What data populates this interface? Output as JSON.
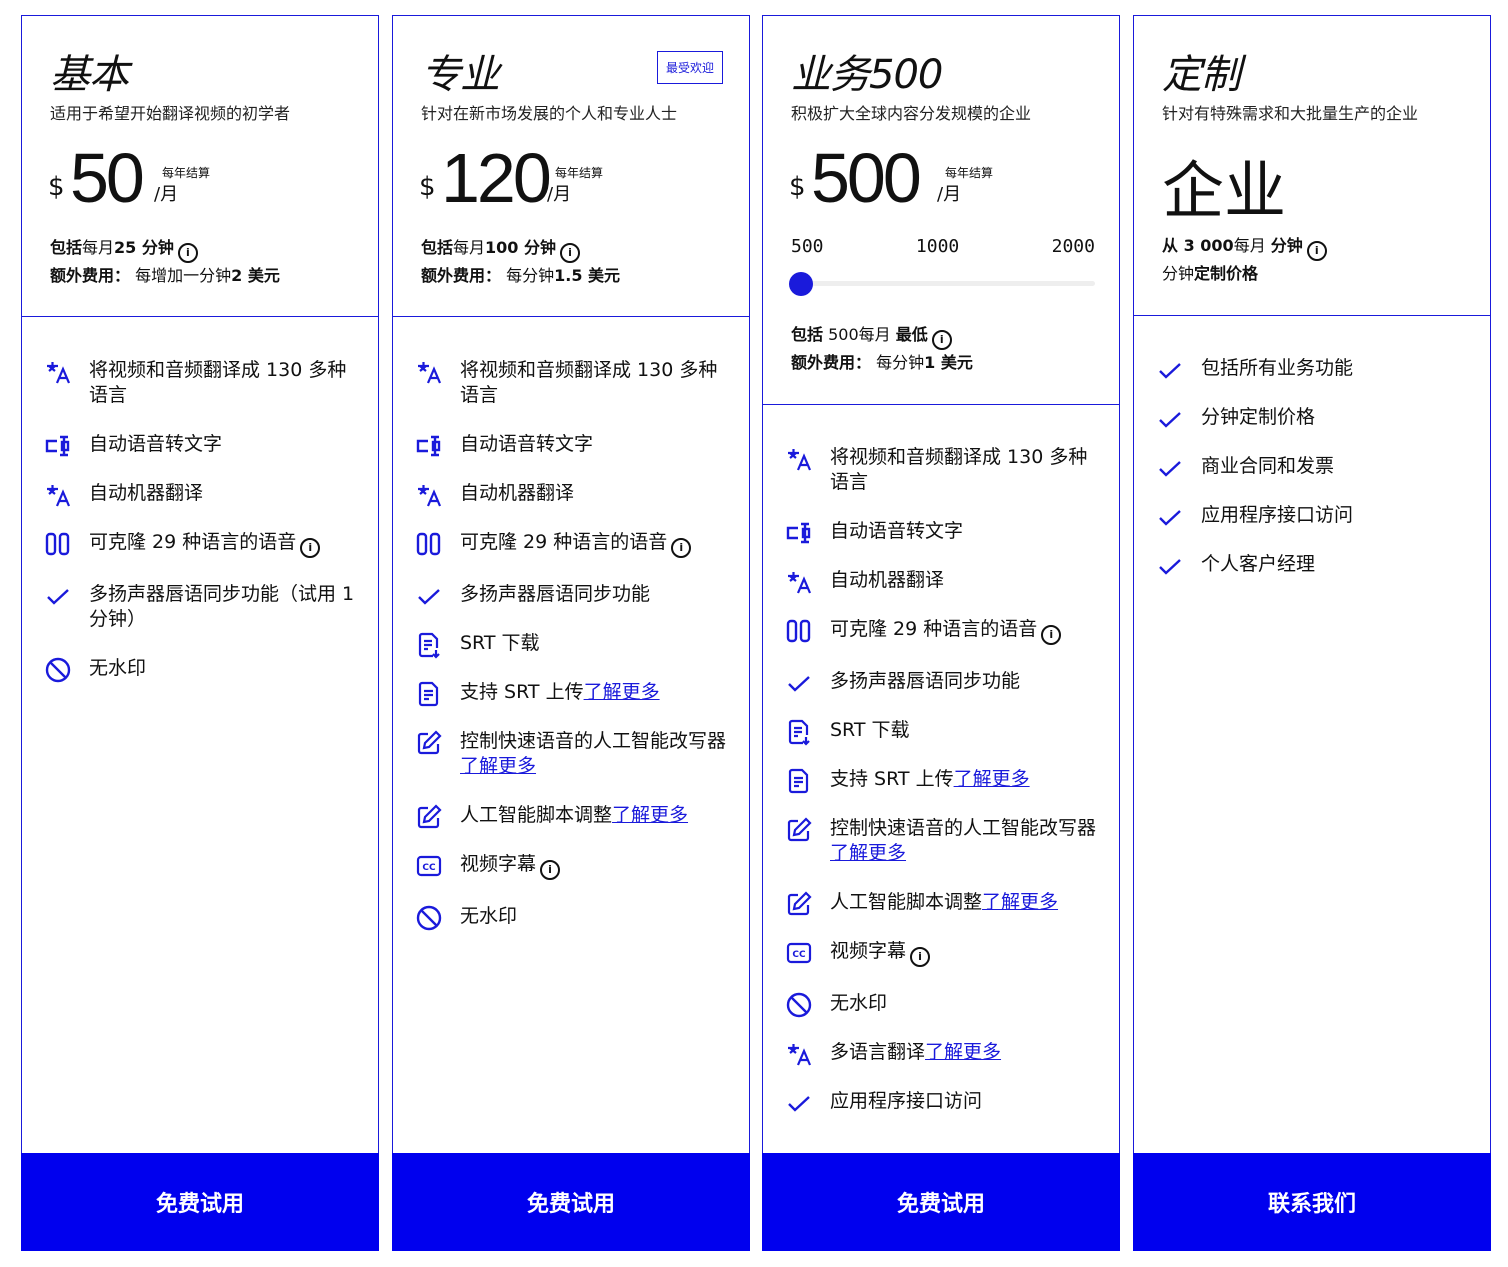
{
  "plans": [
    {
      "title": "基本",
      "subtitle": "适用于希望开始翻译视频的初学者",
      "currency": "$",
      "price": "50",
      "billing": "每年结算",
      "unit": "/月",
      "incl1_bold": "包括",
      "incl1_a": "每月",
      "incl1_b": "25 分钟",
      "incl2_bold": "额外费用：",
      "incl2_a": "每增加一分钟",
      "incl2_b": "2 美元",
      "features": [
        {
          "icon": "translate-icon",
          "text": "将视频和音频翻译成 130 多种语言"
        },
        {
          "icon": "speech-to-text-icon",
          "text": "自动语音转文字"
        },
        {
          "icon": "translate-icon",
          "text": "自动机器翻译"
        },
        {
          "icon": "voice-clone-icon",
          "text": "可克隆 29 种语言的语音",
          "info": "i"
        },
        {
          "icon": "check-icon",
          "text": "多扬声器唇语同步功能（试用 1 分钟）"
        },
        {
          "icon": "no-watermark-icon",
          "text": "无水印"
        }
      ],
      "cta": "免费试用"
    },
    {
      "title": "专业",
      "badge": "最受欢迎",
      "subtitle": "针对在新市场发展的个人和专业人士",
      "currency": "$",
      "price": "120",
      "billing": "每年结算",
      "unit": "/月",
      "incl1_bold": "包括",
      "incl1_a": "每月",
      "incl1_b": "100 分钟",
      "incl2_bold": "额外费用：",
      "incl2_a": "每分钟",
      "incl2_b": "1.5 美元",
      "features": [
        {
          "icon": "translate-icon",
          "text": "将视频和音频翻译成 130 多种语言"
        },
        {
          "icon": "speech-to-text-icon",
          "text": "自动语音转文字"
        },
        {
          "icon": "translate-icon",
          "text": "自动机器翻译"
        },
        {
          "icon": "voice-clone-icon",
          "text": "可克隆 29 种语言的语音",
          "info": "i"
        },
        {
          "icon": "check-icon",
          "text": "多扬声器唇语同步功能"
        },
        {
          "icon": "srt-download-icon",
          "text": "SRT 下载"
        },
        {
          "icon": "srt-upload-icon",
          "text": "支持 SRT 上传",
          "link": "了解更多"
        },
        {
          "icon": "edit-icon",
          "text": "控制快速语音的人工智能改写器",
          "link": "了解更多"
        },
        {
          "icon": "edit-icon",
          "text": "人工智能脚本调整",
          "link": "了解更多"
        },
        {
          "icon": "captions-icon",
          "text": "视频字幕",
          "info": "i"
        },
        {
          "icon": "no-watermark-icon",
          "text": "无水印"
        }
      ],
      "cta": "免费试用"
    },
    {
      "title": "业务500",
      "subtitle": "积极扩大全球内容分发规模的企业",
      "currency": "$",
      "price": "500",
      "billing": "每年结算",
      "unit": "/月",
      "slider": {
        "ticks": [
          "500",
          "1000",
          "2000"
        ],
        "value": 0
      },
      "incl1_bold": "包括",
      "incl1_a": "500每月",
      "incl1_b": "最低",
      "incl2_bold": "额外费用：",
      "incl2_a": "每分钟",
      "incl2_b": "1 美元",
      "features": [
        {
          "icon": "translate-icon",
          "text": "将视频和音频翻译成 130 多种语言"
        },
        {
          "icon": "speech-to-text-icon",
          "text": "自动语音转文字"
        },
        {
          "icon": "translate-icon",
          "text": "自动机器翻译"
        },
        {
          "icon": "voice-clone-icon",
          "text": "可克隆 29 种语言的语音",
          "info": "i"
        },
        {
          "icon": "check-icon",
          "text": "多扬声器唇语同步功能"
        },
        {
          "icon": "srt-download-icon",
          "text": "SRT 下载"
        },
        {
          "icon": "srt-upload-icon",
          "text": "支持 SRT 上传",
          "link": "了解更多"
        },
        {
          "icon": "edit-icon",
          "text": "控制快速语音的人工智能改写器",
          "link": "了解更多"
        },
        {
          "icon": "edit-icon",
          "text": "人工智能脚本调整",
          "link": "了解更多"
        },
        {
          "icon": "captions-icon",
          "text": "视频字幕",
          "info": "i"
        },
        {
          "icon": "no-watermark-icon",
          "text": "无水印"
        },
        {
          "icon": "translate-icon",
          "text": "多语言翻译",
          "link": "了解更多"
        },
        {
          "icon": "check-icon",
          "text": "应用程序接口访问"
        }
      ],
      "cta": "免费试用"
    },
    {
      "title": "定制",
      "subtitle": "针对有特殊需求和大批量生产的企业",
      "enterprise": "企业",
      "incl1_bold": "从 3 000",
      "incl1_a": "每月",
      "incl1_b": "分钟",
      "incl2_a": "分钟",
      "incl2_b": "定制价格",
      "features": [
        {
          "icon": "check-icon",
          "text": "包括所有业务功能"
        },
        {
          "icon": "check-icon",
          "text": "分钟定制价格"
        },
        {
          "icon": "check-icon",
          "text": "商业合同和发票"
        },
        {
          "icon": "check-icon",
          "text": "应用程序接口访问"
        },
        {
          "icon": "check-icon",
          "text": "个人客户经理"
        }
      ],
      "cta": "联系我们"
    }
  ],
  "colors": {
    "accent": "#0000ee",
    "border": "#1a1adb"
  }
}
